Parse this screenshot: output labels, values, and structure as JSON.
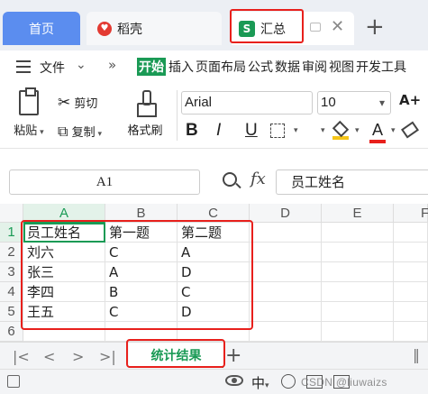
{
  "tabs": {
    "home": "首页",
    "daoke": "稻壳",
    "summary": "汇总",
    "summary_logo": "S",
    "add": "+"
  },
  "menu": {
    "file": "文件",
    "items": [
      "开始",
      "插入",
      "页面布局",
      "公式",
      "数据",
      "审阅",
      "视图",
      "开发工具"
    ]
  },
  "ribbon": {
    "paste": "粘贴",
    "cut": "剪切",
    "copy": "复制",
    "format_painter": "格式刷",
    "font": "Arial",
    "size": "10",
    "font_grow": "A+",
    "bold": "B",
    "italic": "I",
    "underline": "U",
    "font_color": "A"
  },
  "formula_bar": {
    "cell_ref": "A1",
    "fx": "fx",
    "value": "员工姓名"
  },
  "grid": {
    "columns": [
      "A",
      "B",
      "C",
      "D",
      "E",
      "F"
    ],
    "rows": [
      "1",
      "2",
      "3",
      "4",
      "5",
      "6"
    ],
    "cells": [
      [
        "员工姓名",
        "第一题",
        "第二题"
      ],
      [
        "刘六",
        "C",
        "A"
      ],
      [
        "张三",
        "A",
        "D"
      ],
      [
        "李四",
        "B",
        "C"
      ],
      [
        "王五",
        "C",
        "D"
      ]
    ]
  },
  "sheets": {
    "active": "统计结果",
    "add": "+"
  },
  "status": {
    "ime": "中",
    "watermark": "CSDN @liuwaizs"
  },
  "colors": {
    "accent": "#1a9a55",
    "highlight_box": "#e8201c",
    "home_tab": "#5b8def"
  }
}
